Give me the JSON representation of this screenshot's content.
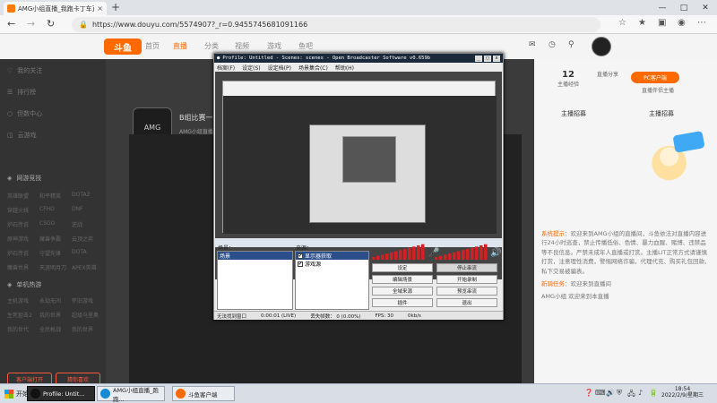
{
  "browser": {
    "tab_title": "AMG小组直播_我跑卡丁车直播",
    "tab_close": "×",
    "new_tab": "+",
    "url": "https://www.douyu.com/5574907?_r=0.9455745681091166",
    "win_minimize": "—",
    "win_maximize": "□",
    "win_close": "✕"
  },
  "topnav": {
    "logo": "斗鱼",
    "items": [
      "首页",
      "直播",
      "分类",
      "视频",
      "游戏",
      "鱼吧"
    ]
  },
  "sidebar": {
    "items": [
      "我的关注",
      "排行榜",
      "但数中心",
      "云游戏"
    ],
    "section1": "网游竞技",
    "grid1": [
      "英雄联盟",
      "和平精英",
      "DOTA2",
      "穿越火线",
      "CFHD",
      "DNF",
      "炉石传说",
      "CSGO",
      "逆战",
      "原神游戏",
      "魔兽争霸",
      "云顶之弈",
      "炉石传说",
      "守望先锋",
      "DOTA",
      "魔兽世界",
      "天涯明月刀",
      "APEX英雄"
    ],
    "section2": "单机热游",
    "grid2": [
      "主机游戏",
      "永劫无间",
      "怀旧游戏",
      "生死狙击2",
      "我的世界",
      "超级马里奥",
      "我的世代",
      "全民枪战",
      "我的世界"
    ],
    "btn_left": "客户端打开",
    "btn_right": "猜你喜欢"
  },
  "room": {
    "avatar_text": "AMG",
    "title": "B组比赛一",
    "sub": "AMG小组直播"
  },
  "right_panel": {
    "stats": [
      {
        "value": "12",
        "label": "主播经验"
      },
      {
        "value": "",
        "label": "直播分享"
      }
    ],
    "icons": [
      "游戏",
      "主播",
      "有鱼视频",
      "更多"
    ],
    "pc_button": "PC客户端",
    "pc_sub": "直播伴侣主播",
    "tabs": [
      "主播招募",
      "主播招募"
    ],
    "chat": [
      {
        "user": "系统提示：",
        "text": "欢迎来到AMG小组的直播间，斗鱼依法对直播内容进行24小时巡查，禁止传播低俗、色情、暴力血腥、赌博、违禁品等不良信息。严禁未成年人直播或打赏。主播LIT正常方式请谨慎打赏，注意理性消费，警惕网络诈骗，代理代充、购买礼包回款、私下交易被骗表。"
      },
      {
        "user": "新骑任务：",
        "text": "欢迎来到直播间"
      }
    ],
    "chat_footer": "AMG小组 欢迎来到本直播"
  },
  "obs": {
    "title": "Profile: Untitled - Scenes: scenes - Open Broadcaster Software v0.659b",
    "menu": [
      "档案(F)",
      "设定(S)",
      "设定档(P)",
      "场景集合(C)",
      "帮助(H)"
    ],
    "scenes_label": "场景：",
    "sources_label": "来源：",
    "scenes": [
      "场景"
    ],
    "sources": [
      "显示器获取",
      "游戏源"
    ],
    "buttons": [
      {
        "label": "设定",
        "pressed": false
      },
      {
        "label": "停止串流",
        "pressed": true
      },
      {
        "label": "编辑场景",
        "pressed": false
      },
      {
        "label": "开始录制",
        "pressed": false
      },
      {
        "label": "全域来源",
        "pressed": false
      },
      {
        "label": "预览串流",
        "pressed": false
      },
      {
        "label": "插件",
        "pressed": false
      },
      {
        "label": "退出",
        "pressed": false
      }
    ],
    "status": [
      "无法找到窗口",
      "0:00:01 (LIVE)",
      "丢失帧数： 0 (0.00%)",
      "FPS: 30",
      "0kb/s"
    ]
  },
  "taskbar": {
    "start": "开始",
    "tasks": [
      {
        "label": "Profile: Untit...",
        "active": true,
        "color": "#111111"
      },
      {
        "label": "AMG小组直播_跑跑...",
        "active": false,
        "color": "#1a8ad4"
      },
      {
        "label": "斗鱼客户端",
        "active": false,
        "color": "#ff6a00"
      }
    ],
    "tray_icons": [
      "❓",
      "⌨",
      "🔊",
      "⛨",
      "🖧",
      "♪",
      "🔋"
    ],
    "time": "18:54",
    "date": "2022/2/9/星期三"
  }
}
